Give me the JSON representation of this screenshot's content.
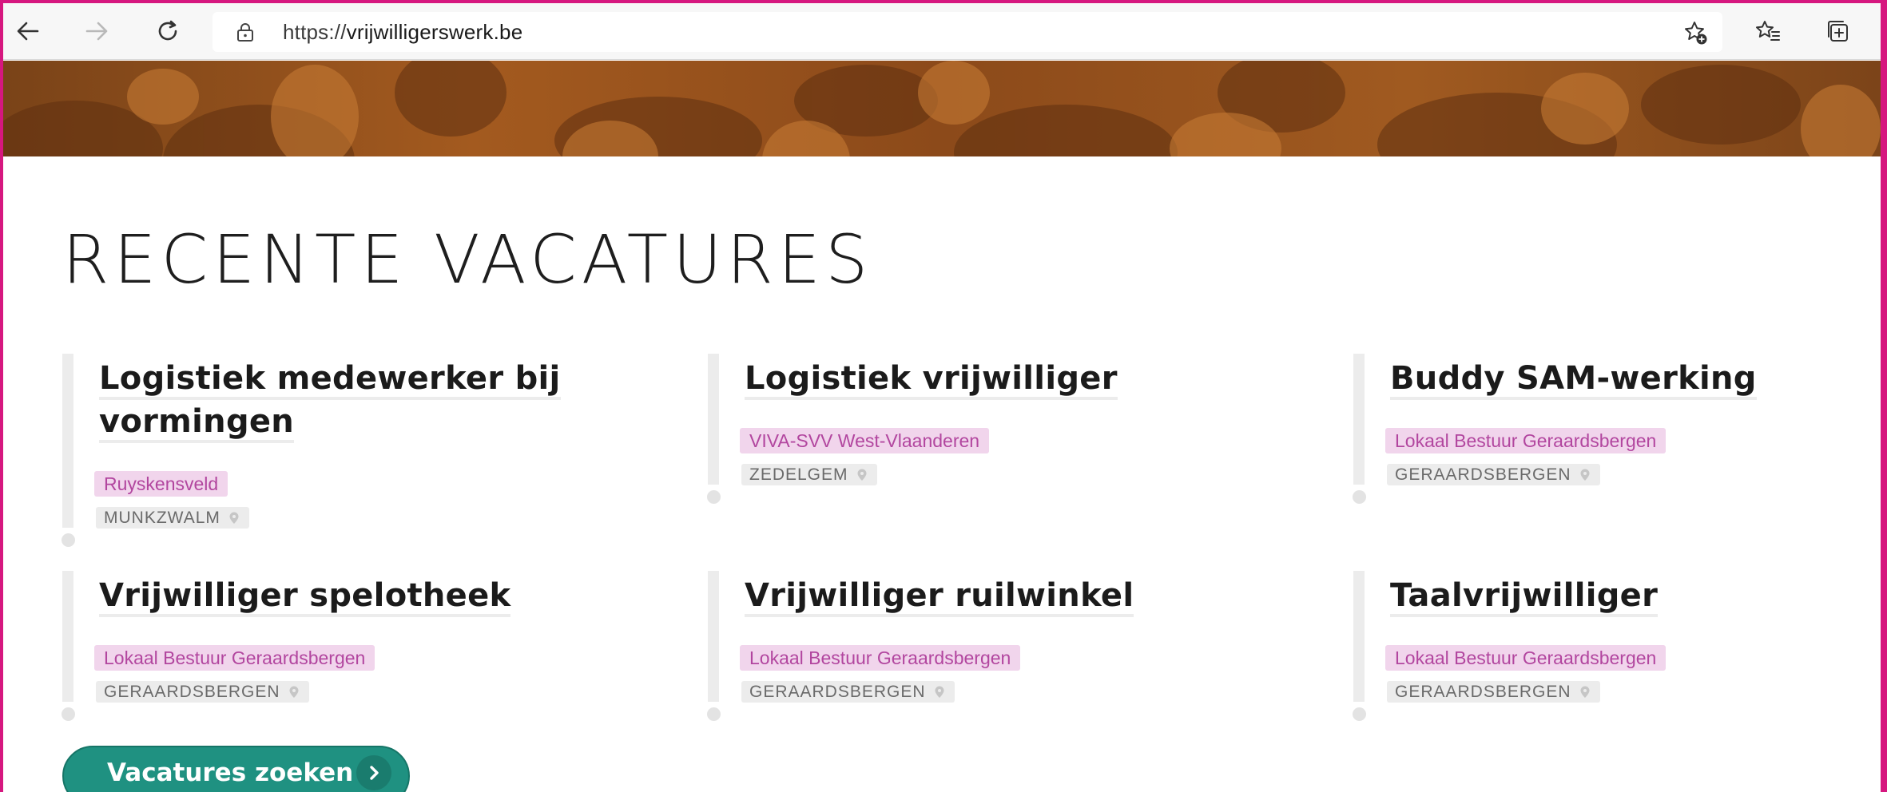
{
  "browser": {
    "url_prefix": "https://",
    "url_domain": "vrijwilligerswerk.be",
    "back_icon": "arrow-left-icon",
    "forward_icon": "arrow-right-icon",
    "reload_icon": "reload-icon",
    "lock_icon": "lock-icon",
    "add_favorite_icon": "star-plus-icon",
    "favorites_icon": "favorites-list-icon",
    "collections_icon": "collections-icon"
  },
  "section": {
    "title": "RECENTE VACATURES"
  },
  "vacancies": [
    {
      "title": "Logistiek medewerker bij vormingen",
      "organisation": "Ruyskensveld",
      "location": "MUNKZWALM"
    },
    {
      "title": "Logistiek vrijwilliger",
      "organisation": "VIVA-SVV West-Vlaanderen",
      "location": "ZEDELGEM"
    },
    {
      "title": "Buddy SAM-werking",
      "organisation": "Lokaal Bestuur Geraardsbergen",
      "location": "GERAARDSBERGEN"
    },
    {
      "title": "Vrijwilliger spelotheek",
      "organisation": "Lokaal Bestuur Geraardsbergen",
      "location": "GERAARDSBERGEN"
    },
    {
      "title": "Vrijwilliger ruilwinkel",
      "organisation": "Lokaal Bestuur Geraardsbergen",
      "location": "GERAARDSBERGEN"
    },
    {
      "title": "Taalvrijwilliger",
      "organisation": "Lokaal Bestuur Geraardsbergen",
      "location": "GERAARDSBERGEN"
    }
  ],
  "search_button": {
    "label": "Vacatures zoeken"
  },
  "colors": {
    "accent_pink": "#d6177f",
    "org_tag_bg": "#f1d5ec",
    "org_tag_text": "#b2469f",
    "button_teal": "#1f9181",
    "hero_orange": "#a35a1f"
  }
}
